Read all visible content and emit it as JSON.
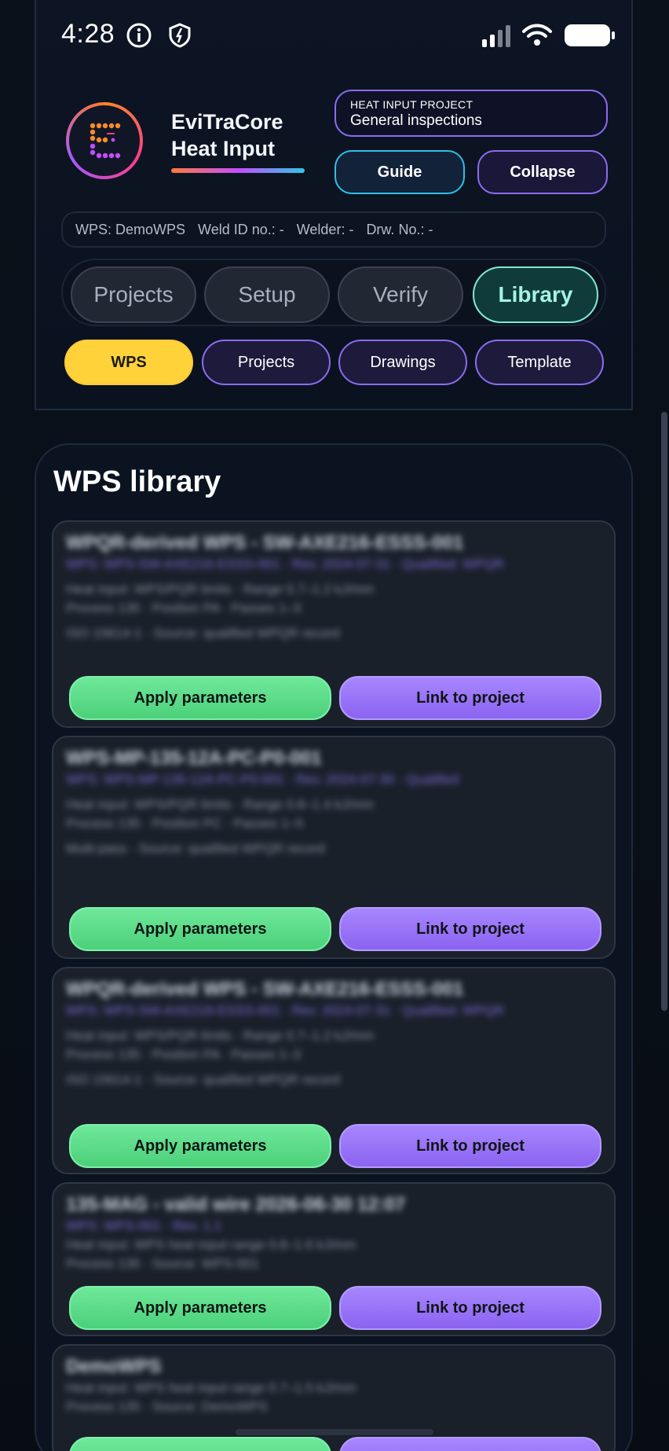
{
  "status_bar": {
    "time": "4:28",
    "icons": [
      "info-icon",
      "shield-icon",
      "signal-icon",
      "wifi-icon",
      "battery-icon"
    ]
  },
  "header": {
    "app_title_line1": "EviTraCore",
    "app_title_line2": "Heat Input",
    "project_label": "HEAT INPUT PROJECT",
    "project_value": "General inspections",
    "guide_label": "Guide",
    "collapse_label": "Collapse"
  },
  "info_strip": {
    "wps": "WPS: DemoWPS",
    "weld_id": "Weld ID no.: -",
    "welder": "Welder: -",
    "drawing": "Drw. No.: -"
  },
  "main_tabs": [
    {
      "label": "Projects",
      "active": false
    },
    {
      "label": "Setup",
      "active": false
    },
    {
      "label": "Verify",
      "active": false
    },
    {
      "label": "Library",
      "active": true
    }
  ],
  "sub_tabs": [
    {
      "label": "WPS",
      "active": true
    },
    {
      "label": "Projects",
      "active": false
    },
    {
      "label": "Drawings",
      "active": false
    },
    {
      "label": "Template",
      "active": false
    }
  ],
  "library": {
    "title": "WPS library",
    "apply_label": "Apply parameters",
    "link_label": "Link to project",
    "items": [
      {
        "title": "WPQR-derived WPS - SW-AXE216-ESSS-001",
        "lines": [
          "WPS: WPS-SW-AXE216-ESSS-001 · Rev. 2024-07-31 · Qualified: WPQR",
          "Heat input: WPS/PQR limits · Range 0.7–1.2 kJ/mm",
          "Process 135 · Position PA · Passes 1–3",
          "ISO 15614-1 · Source: qualified WPQR record"
        ]
      },
      {
        "title": "WPS-MP-135-12A-PC-P0-001",
        "lines": [
          "WPS: WPS-MP-135-12A-PC-P0-001 · Rev. 2024-07-30 · Qualified",
          "Heat input: WPS/PQR limits · Range 0.8–1.4 kJ/mm",
          "Process 135 · Position PC · Passes 1–5",
          "Multi-pass · Source: qualified WPQR record"
        ]
      },
      {
        "title": "WPQR-derived WPS - SW-AXE216-ESSS-001",
        "lines": [
          "WPS: WPS-SW-AXE216-ESSS-001 · Rev. 2024-07-31 · Qualified: WPQR",
          "Heat input: WPS/PQR limits · Range 0.7–1.2 kJ/mm",
          "Process 135 · Position PA · Passes 1–3",
          "ISO 15614-1 · Source: qualified WPQR record"
        ]
      },
      {
        "title": "135-MAG - valid wire 2026-06-30 12:07",
        "lines": [
          "WPS: WPS-001 · Rev. 1.1",
          "Heat input: WPS heat input range 0.8–1.6 kJ/mm",
          "Process 135 · Source: WPS-001"
        ]
      },
      {
        "title": "DemoWPS",
        "lines": [
          "Heat input: WPS heat input range 0.7–1.5 kJ/mm",
          "Process 135 · Source: DemoWPS"
        ]
      }
    ]
  }
}
